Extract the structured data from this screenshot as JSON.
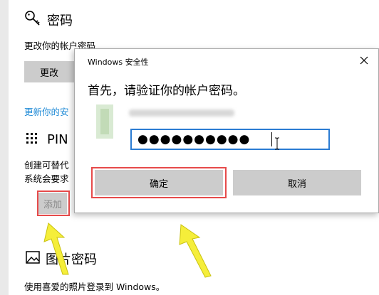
{
  "password_section": {
    "title": "密码",
    "description": "更改你的帐户密码",
    "change_button": "更改",
    "update_link": "更新你的安"
  },
  "pin_section": {
    "title": "PIN",
    "description_line1": "创建可替代",
    "description_line2": "系统会要求",
    "add_button": "添加"
  },
  "picture_password_section": {
    "title": "图片密码",
    "description": "使用喜爱的照片登录到 Windows。"
  },
  "dialog": {
    "title": "Windows 安全性",
    "heading": "首先，请验证你的帐户密码。",
    "password_value": "●●●●●●●●●●",
    "ok_button": "确定",
    "cancel_button": "取消"
  },
  "colors": {
    "highlight_box": "#e64a4a",
    "arrow": "#f5ee3a",
    "input_border": "#2b7cd3",
    "link": "#1f8ad6"
  }
}
